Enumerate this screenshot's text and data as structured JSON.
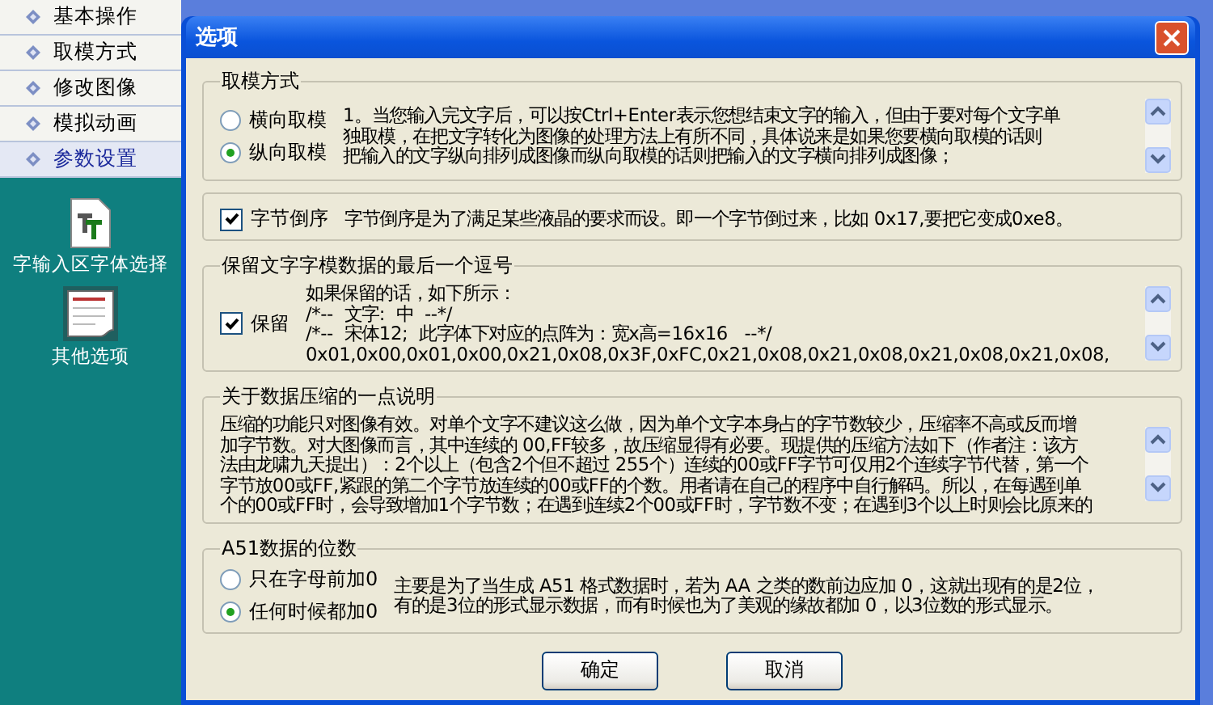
{
  "sidebar": {
    "items": [
      {
        "label": "基本操作",
        "selected": false
      },
      {
        "label": "取模方式",
        "selected": false
      },
      {
        "label": "修改图像",
        "selected": false
      },
      {
        "label": "模拟动画",
        "selected": false
      },
      {
        "label": "参数设置",
        "selected": true
      }
    ]
  },
  "desktop_icons": [
    {
      "label": "字输入区字体选择",
      "kind": "font"
    },
    {
      "label": "其他选项",
      "kind": "note"
    }
  ],
  "dialog": {
    "title": "选项",
    "groups": [
      {
        "kind": "radio",
        "legend": "取模方式",
        "options": [
          {
            "label": "横向取模",
            "selected": false
          },
          {
            "label": "纵向取模",
            "selected": true
          }
        ],
        "scrollbar": true,
        "lines": [
          "1。当您输入完文字后，可以按Ctrl+Enter表示您想结束文字的输入，但由于要对每个文字单",
          "独取模，在把文字转化为图像的处理方法上有所不同，具体说来是如果您要横向取模的话则",
          "把输入的文字纵向排列成图像而纵向取模的话则把输入的文字横向排列成图像；"
        ]
      },
      {
        "kind": "checkbox",
        "options": [
          {
            "label": "字节倒序",
            "checked": true
          }
        ],
        "scrollbar": false,
        "lines": [
          "字节倒序是为了满足某些液晶的要求而设。即一个字节倒过来，比如 0x17,要把它变成0xe8。"
        ]
      },
      {
        "kind": "checkbox",
        "legend": "保留文字字模数据的最后一个逗号",
        "options": [
          {
            "label": "保留",
            "checked": true
          }
        ],
        "scrollbar": true,
        "lines": [
          "如果保留的话，如下所示：",
          "/*--  文字:  中  --*/",
          "/*--  宋体12;  此字体下对应的点阵为：宽x高=16x16   --*/",
          "0x01,0x00,0x01,0x00,0x21,0x08,0x3F,0xFC,0x21,0x08,0x21,0x08,0x21,0x08,0x21,0x08,"
        ]
      },
      {
        "kind": "text",
        "legend": "关于数据压缩的一点说明",
        "scrollbar": true,
        "lines": [
          "压缩的功能只对图像有效。对单个文字不建议这么做，因为单个文字本身占的字节数较少，压缩率不高或反而增",
          "加字节数。对大图像而言，其中连续的 00,FF较多，故压缩显得有必要。现提供的压缩方法如下（作者注：该方",
          "法由龙啸九天提出）：2个以上（包含2个但不超过 255个）连续的00或FF字节可仅用2个连续字节代替，第一个",
          "字节放00或FF,紧跟的第二个字节放连续的00或FF的个数。用者请在自己的程序中自行解码。所以，在每遇到单",
          "个的00或FF时，会导致增加1个字节数；在遇到连续2个00或FF时，字节数不变；在遇到3个以上时则会比原来的"
        ]
      },
      {
        "kind": "radio",
        "legend": "A51数据的位数",
        "options": [
          {
            "label": "只在字母前加0",
            "selected": false
          },
          {
            "label": "任何时候都加0",
            "selected": true
          }
        ],
        "scrollbar": false,
        "lines": [
          "主要是为了当生成 A51 格式数据时，若为 AA 之类的数前边应加 0，这就出现有的是2位，",
          "有的是3位的形式显示数据，而有时候也为了美观的缘故都加 0，以3位数的形式显示。"
        ]
      }
    ]
  },
  "buttons": [
    "确定",
    "取消"
  ]
}
